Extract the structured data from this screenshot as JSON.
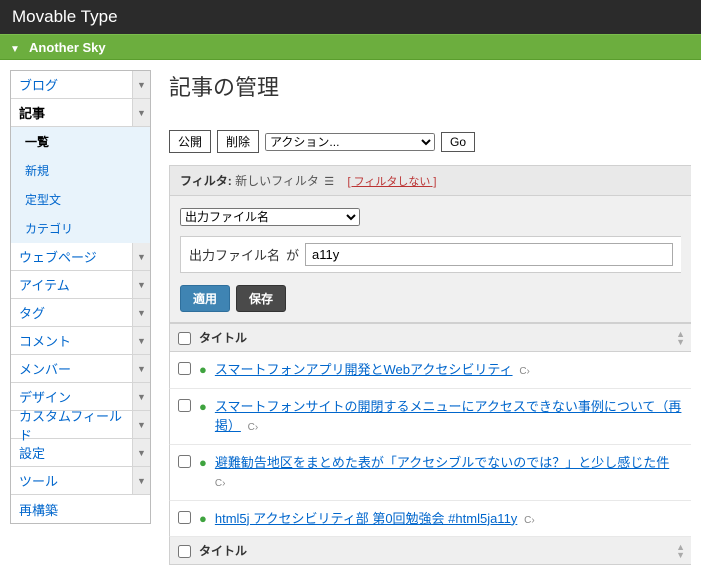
{
  "brand": "Movable Type",
  "site": "Another Sky",
  "sidebar": {
    "items": [
      {
        "label": "ブログ",
        "expandable": true
      },
      {
        "label": "記事",
        "expandable": true,
        "active": true,
        "sub": [
          {
            "label": "一覧",
            "active": true
          },
          {
            "label": "新規"
          },
          {
            "label": "定型文"
          },
          {
            "label": "カテゴリ"
          }
        ]
      },
      {
        "label": "ウェブページ",
        "expandable": true
      },
      {
        "label": "アイテム",
        "expandable": true
      },
      {
        "label": "タグ",
        "expandable": true
      },
      {
        "label": "コメント",
        "expandable": true
      },
      {
        "label": "メンバー",
        "expandable": true
      },
      {
        "label": "デザイン",
        "expandable": true
      },
      {
        "label": "カスタムフィールド",
        "expandable": true
      },
      {
        "label": "設定",
        "expandable": true
      },
      {
        "label": "ツール",
        "expandable": true
      },
      {
        "label": "再構築",
        "expandable": false
      }
    ]
  },
  "page_title": "記事の管理",
  "toolbar": {
    "publish": "公開",
    "delete": "削除",
    "action_placeholder": "アクション...",
    "go": "Go"
  },
  "filter": {
    "label": "フィルタ:",
    "name": "新しいフィルタ",
    "clear": "フィルタしない",
    "field_select": "出力ファイル名",
    "cond_label": "出力ファイル名",
    "cond_op": "が",
    "cond_value": "a11y",
    "apply": "適用",
    "save": "保存"
  },
  "list": {
    "select_all": false,
    "col_title": "タイトル",
    "rows": [
      {
        "title": "スマートフォンアプリ開発とWebアクセシビリティ"
      },
      {
        "title": "スマートフォンサイトの開閉するメニューにアクセスできない事例について（再掲）"
      },
      {
        "title": "避難勧告地区をまとめた表が「アクセシブルでないのでは？」と少し感じた件"
      },
      {
        "title": "html5j アクセシビリティ部 第0回勉強会 #html5ja11y"
      }
    ]
  }
}
